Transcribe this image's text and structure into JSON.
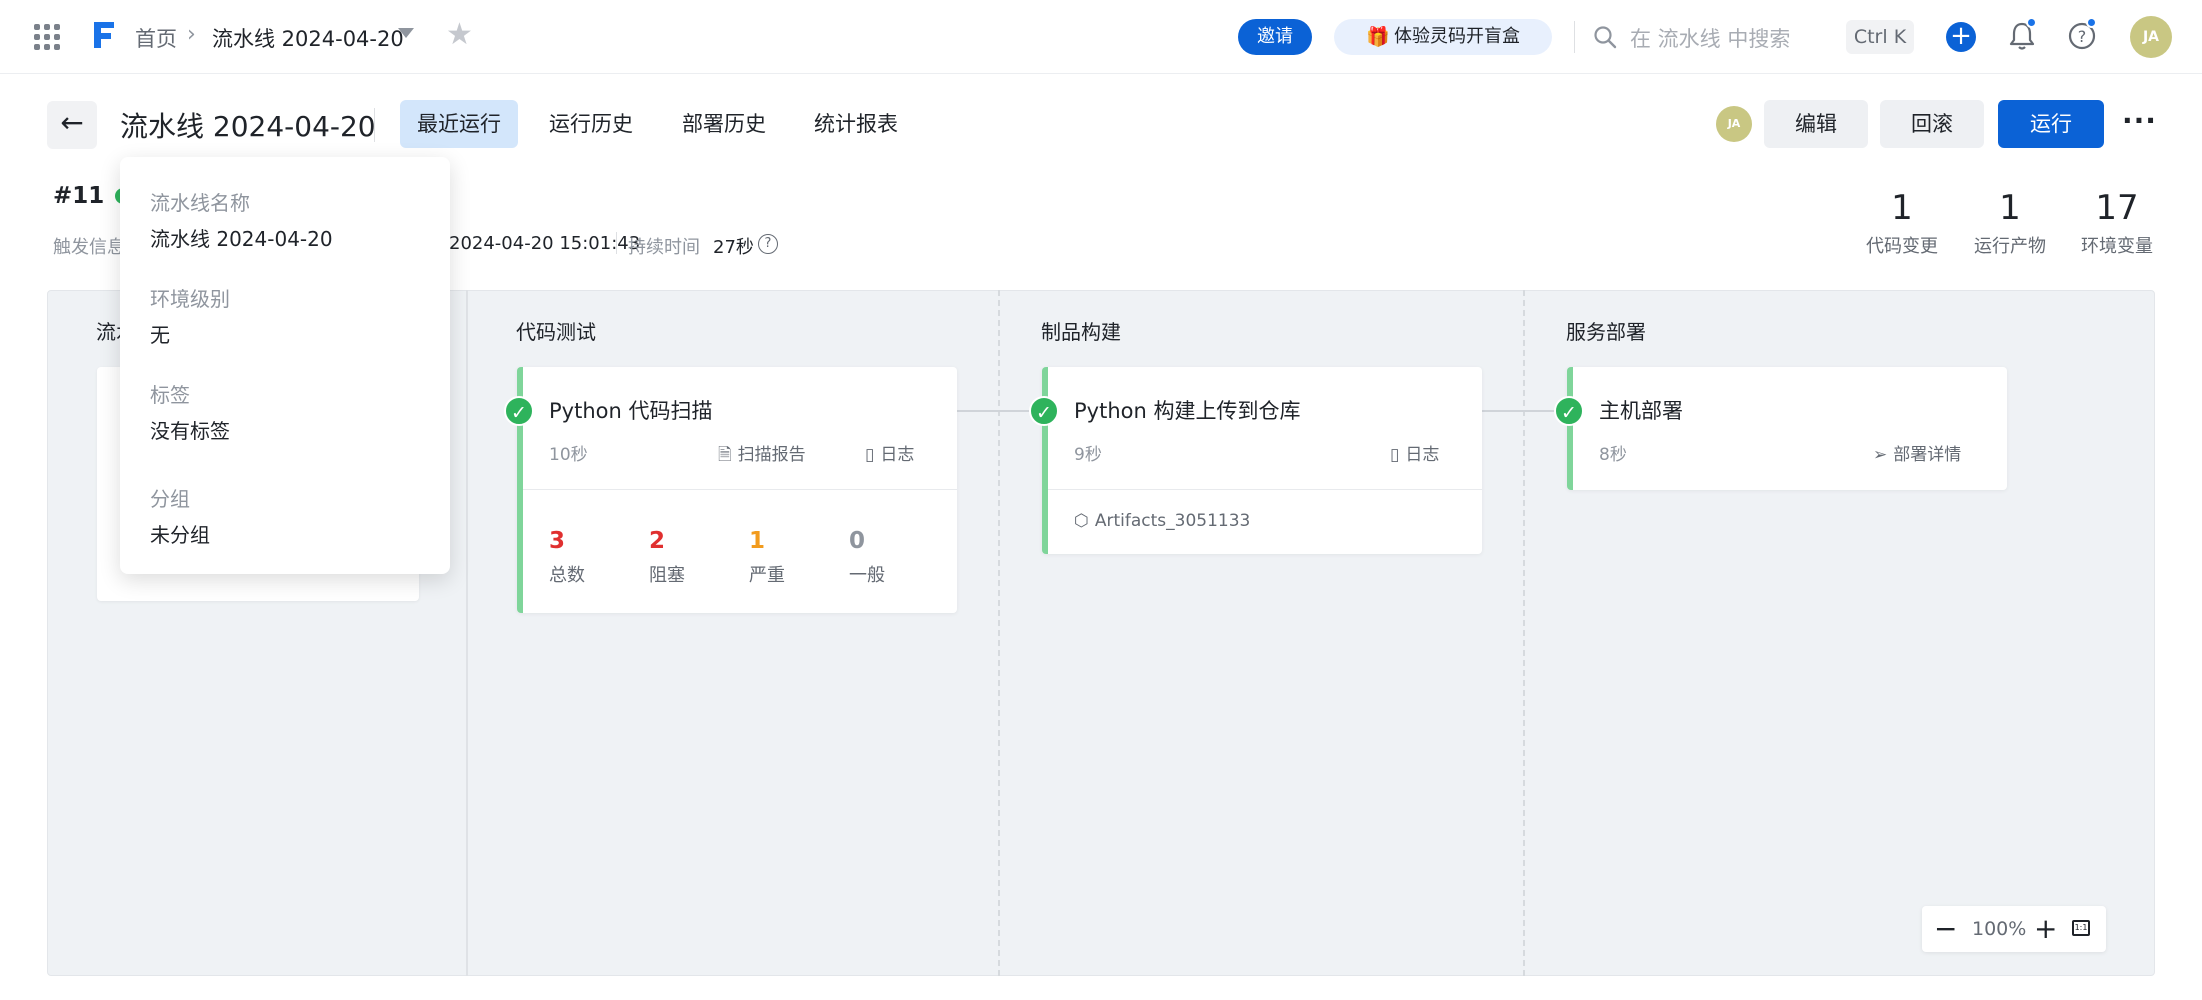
{
  "breadcrumb": {
    "home": "首页",
    "current": "流水线 2024-04-20"
  },
  "topbar": {
    "invite": "邀请",
    "gift": "体验灵码开盲盒",
    "search_placeholder": "在 流水线 中搜索",
    "shortcut": "Ctrl K",
    "avatar": "JA"
  },
  "header": {
    "title": "流水线 2024-04-20",
    "tabs": [
      "最近运行",
      "运行历史",
      "部署历史",
      "统计报表"
    ],
    "active_tab": "最近运行",
    "avatar": "JA",
    "edit": "编辑",
    "rollback": "回滚",
    "run": "运行"
  },
  "run": {
    "number": "#11",
    "trigger_label": "触发信息",
    "time": "2024-04-20 15:01:43",
    "duration_label": "持续时间",
    "duration": "27秒"
  },
  "stats": [
    {
      "value": "1",
      "label": "代码变更"
    },
    {
      "value": "1",
      "label": "运行产物"
    },
    {
      "value": "17",
      "label": "环境变量"
    }
  ],
  "stages": {
    "source": "流水线源",
    "test": "代码测试",
    "build": "制品构建",
    "deploy": "服务部署"
  },
  "jobs": {
    "scan": {
      "name": "Python 代码扫描",
      "time": "10秒",
      "report": "扫描报告",
      "log": "日志",
      "metrics": [
        {
          "value": "3",
          "label": "总数",
          "color": "#e02f2f"
        },
        {
          "value": "2",
          "label": "阻塞",
          "color": "#e02f2f"
        },
        {
          "value": "1",
          "label": "严重",
          "color": "#f29b1d"
        },
        {
          "value": "0",
          "label": "一般",
          "color": "#8f959e"
        }
      ]
    },
    "build": {
      "name": "Python 构建上传到仓库",
      "time": "9秒",
      "log": "日志",
      "artifact": "Artifacts_3051133"
    },
    "deploy": {
      "name": "主机部署",
      "time": "8秒",
      "detail": "部署详情"
    }
  },
  "zoom": {
    "value": "100%"
  },
  "popover": {
    "name_label": "流水线名称",
    "name_value": "流水线 2024-04-20",
    "env_label": "环境级别",
    "env_value": "无",
    "tag_label": "标签",
    "tag_value": "没有标签",
    "group_label": "分组",
    "group_value": "未分组"
  },
  "colors": {
    "primary": "#0b62d6",
    "success": "#2eb35c",
    "card_border": "#7fd59a"
  }
}
